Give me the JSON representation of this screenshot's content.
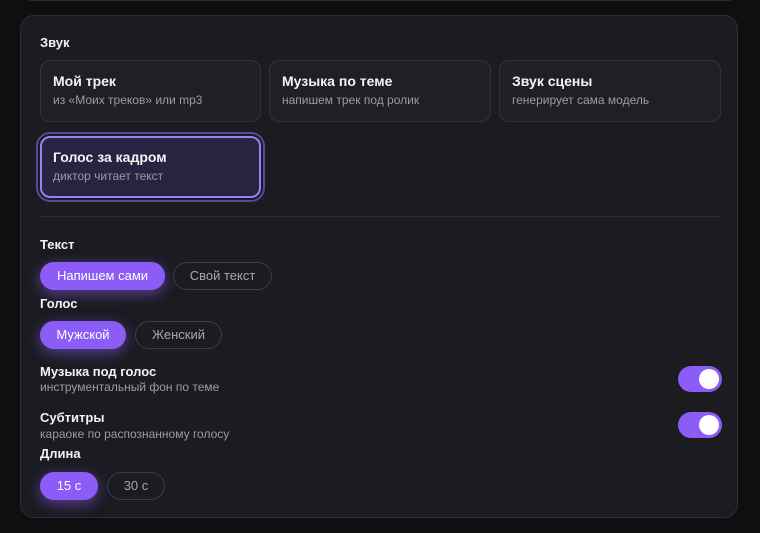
{
  "sound": {
    "label": "Звук",
    "options": [
      {
        "title": "Мой трек",
        "subtitle": "из «Моих треков» или mp3",
        "selected": false
      },
      {
        "title": "Музыка по теме",
        "subtitle": "напишем трек под ролик",
        "selected": false
      },
      {
        "title": "Звук сцены",
        "subtitle": "генерирует сама модель",
        "selected": false
      },
      {
        "title": "Голос за кадром",
        "subtitle": "диктор читает текст",
        "selected": true
      }
    ]
  },
  "text": {
    "label": "Текст",
    "options": [
      "Напишем сами",
      "Свой текст"
    ],
    "selected": "Напишем сами"
  },
  "voice": {
    "label": "Голос",
    "options": [
      "Мужской",
      "Женский"
    ],
    "selected": "Мужской"
  },
  "music_under_voice": {
    "title": "Музыка под голос",
    "subtitle": "инструментальный фон по теме",
    "enabled": true
  },
  "subtitles": {
    "title": "Субтитры",
    "subtitle": "караоке по распознанному голосу",
    "enabled": true
  },
  "duration": {
    "label": "Длина",
    "options": [
      "15 с",
      "30 с"
    ],
    "selected": "15 с"
  },
  "colors": {
    "accent": "#8b5cf6",
    "panel": "#1b1b20",
    "background": "#0f0f12"
  }
}
